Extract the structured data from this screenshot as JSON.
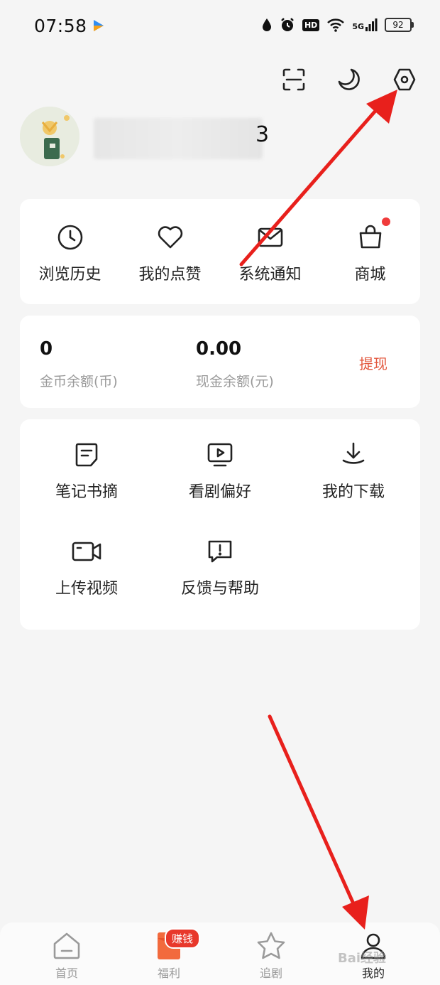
{
  "status": {
    "time": "07:58",
    "network": "5G",
    "hd": "HD",
    "battery": "92"
  },
  "top_actions": [
    "scan-icon",
    "moon-icon",
    "settings-icon"
  ],
  "profile": {
    "username_suffix": "3"
  },
  "quick_actions": [
    {
      "label": "浏览历史",
      "icon": "clock-icon"
    },
    {
      "label": "我的点赞",
      "icon": "heart-icon"
    },
    {
      "label": "系统通知",
      "icon": "envelope-icon"
    },
    {
      "label": "商城",
      "icon": "shopping-bag-icon",
      "has_dot": true
    }
  ],
  "wallet": {
    "coins_value": "0",
    "coins_label": "金币余额(币)",
    "cash_value": "0.00",
    "cash_label": "现金余额(元)",
    "withdraw_label": "提现"
  },
  "tools": [
    {
      "label": "笔记书摘",
      "icon": "note-icon"
    },
    {
      "label": "看剧偏好",
      "icon": "tv-icon"
    },
    {
      "label": "我的下载",
      "icon": "download-icon"
    },
    {
      "label": "上传视频",
      "icon": "video-camera-icon"
    },
    {
      "label": "反馈与帮助",
      "icon": "feedback-icon"
    }
  ],
  "tabbar": [
    {
      "label": "首页",
      "icon": "home-icon"
    },
    {
      "label": "福利",
      "icon": "red-envelope-icon",
      "badge": "赚钱"
    },
    {
      "label": "追剧",
      "icon": "star-icon"
    },
    {
      "label": "我的",
      "icon": "user-icon",
      "active": true
    }
  ],
  "watermark": "Bai经验",
  "colors": {
    "accent": "#e2553b",
    "badge": "#e8382b",
    "annotation_arrow": "#e8201c"
  }
}
